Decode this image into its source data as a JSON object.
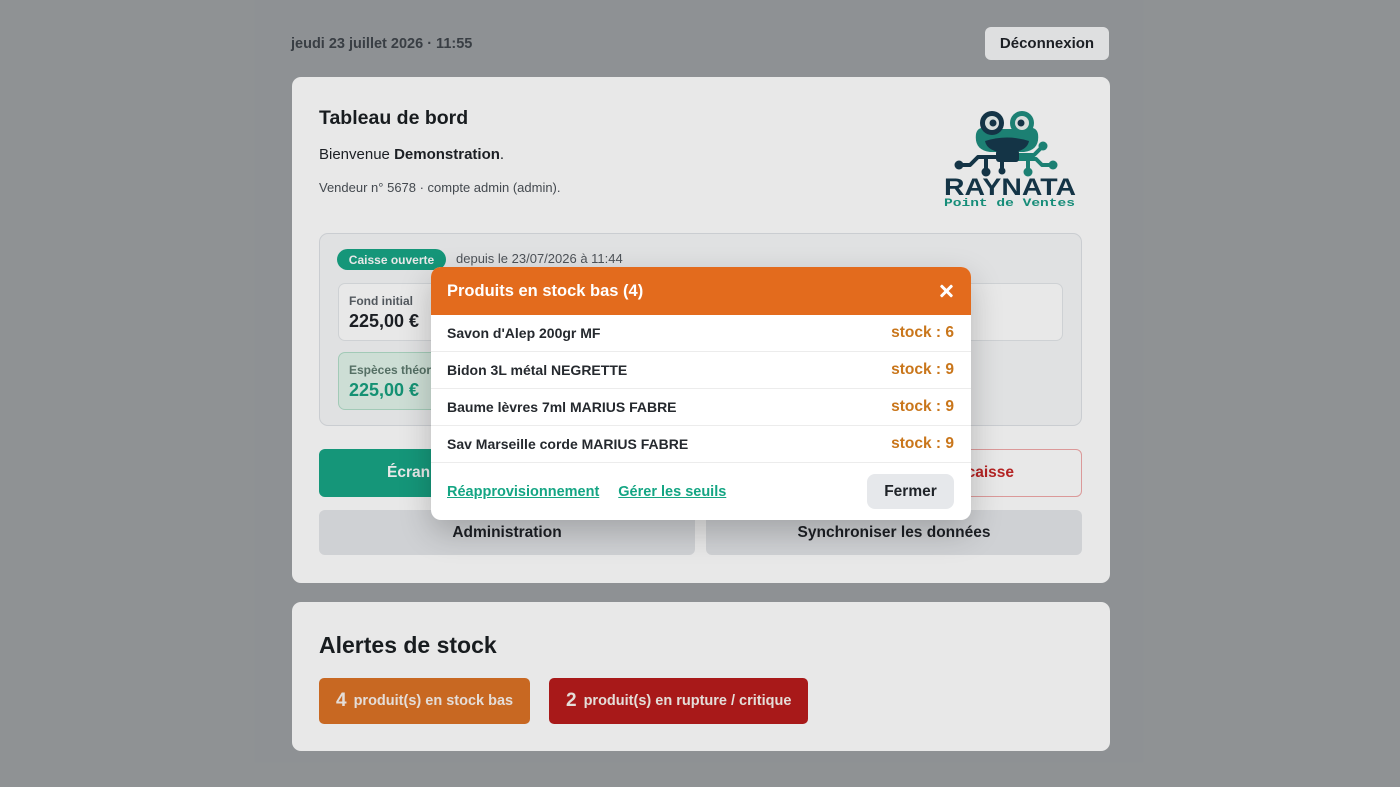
{
  "header": {
    "datetime": "jeudi 23 juillet 2026 · 11:55",
    "logout_label": "Déconnexion"
  },
  "dashboard": {
    "title": "Tableau de bord",
    "welcome_prefix": "Bienvenue ",
    "user_name": "Demonstration",
    "welcome_suffix": ".",
    "seller_info": "Vendeur n° 5678 · compte admin (admin).",
    "logo": {
      "name": "RAYNATA",
      "tagline": "Point de Ventes",
      "icon": "frog-mascot-icon"
    },
    "register": {
      "status": "Caisse ouverte",
      "opened_since": "depuis le 23/07/2026 à 11:44",
      "initial_float": {
        "label": "Fond initial",
        "value": "225,00 €"
      },
      "expected_cash": {
        "label": "Espèces théor",
        "value": "225,00 €"
      }
    },
    "actions": {
      "sales_screen": "Écran",
      "close_register": "caisse",
      "administration": "Administration",
      "sync": "Synchroniser les données"
    }
  },
  "stock_alerts": {
    "title": "Alertes de stock",
    "low_stock": {
      "count": "4",
      "label": "produit(s) en stock bas"
    },
    "out_of_stock": {
      "count": "2",
      "label": "produit(s) en rupture / critique"
    }
  },
  "modal": {
    "title": "Produits en stock bas (4)",
    "close_icon": "close-icon",
    "items": [
      {
        "name": "Savon d'Alep 200gr MF",
        "stock": "stock : 6"
      },
      {
        "name": "Bidon 3L métal NEGRETTE",
        "stock": "stock : 9"
      },
      {
        "name": "Baume lèvres 7ml MARIUS FABRE",
        "stock": "stock : 9"
      },
      {
        "name": "Sav Marseille corde MARIUS FABRE",
        "stock": "stock : 9"
      }
    ],
    "links": {
      "restock": "Réapprovisionnement",
      "thresholds": "Gérer les seuils"
    },
    "close_label": "Fermer"
  },
  "colors": {
    "modal_header": "#e36b1d",
    "accent_green": "#18a585",
    "stock_level_text": "#c9761b",
    "low_stock_badge": "#dc7326",
    "critical_badge": "#b91c1c",
    "danger": "#c62828"
  }
}
